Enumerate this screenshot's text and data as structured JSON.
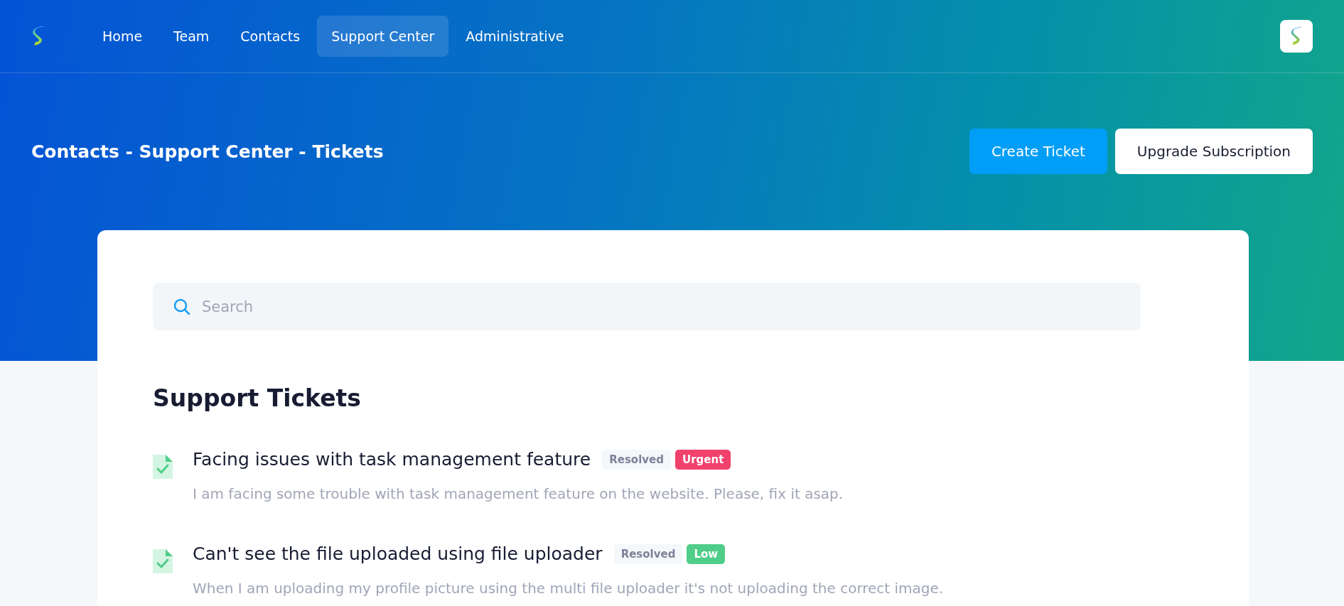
{
  "nav": {
    "items": [
      {
        "label": "Home",
        "selected": false
      },
      {
        "label": "Team",
        "selected": false
      },
      {
        "label": "Contacts",
        "selected": false
      },
      {
        "label": "Support Center",
        "selected": true
      },
      {
        "label": "Administrative",
        "selected": false
      }
    ]
  },
  "header": {
    "breadcrumb": "Contacts - Support Center - Tickets",
    "buttons": [
      "Create Ticket",
      "Upgrade Subscription"
    ]
  },
  "search": {
    "placeholder": "Search"
  },
  "tickets": {
    "title": "Support Tickets",
    "items": [
      {
        "title": "Facing issues with task management feature",
        "status": "Resolved",
        "priority": "Urgent",
        "color": "#f1416c",
        "description": "I am facing some trouble with task management feature on the website. Please, fix it asap."
      },
      {
        "title": "Can't see the file uploaded using file uploader",
        "status": "Resolved",
        "priority": "Low",
        "color": "#50cd89",
        "description": "When I am uploading my profile picture using the multi file uploader it's not uploading the correct image."
      }
    ]
  }
}
